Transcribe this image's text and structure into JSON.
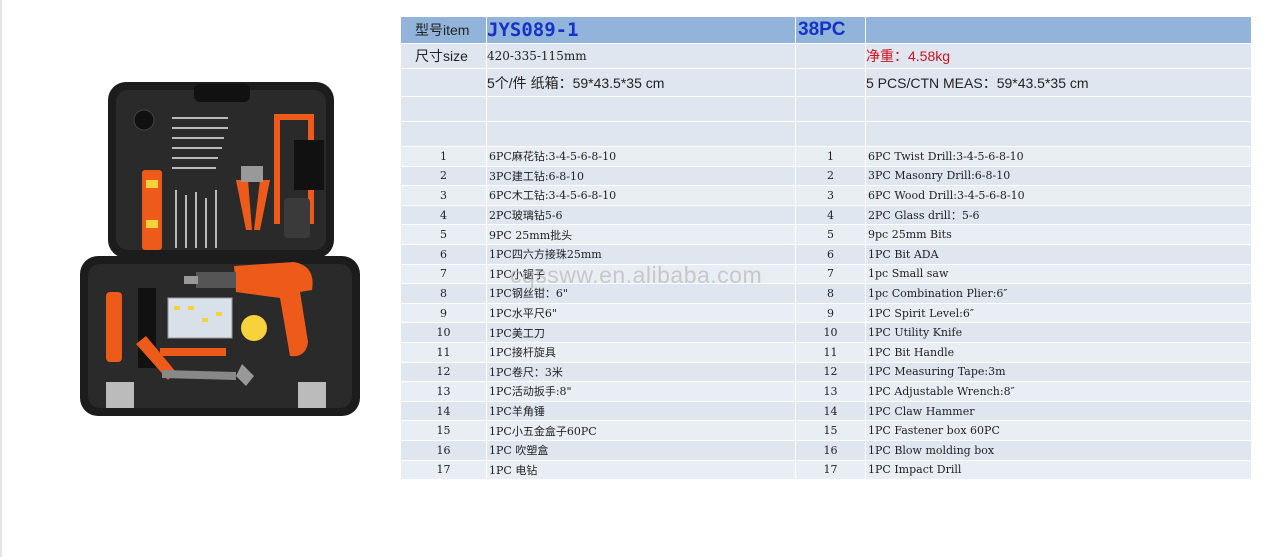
{
  "header": {
    "label": "型号item",
    "model": "JYS089-1",
    "piece_count": "38PC"
  },
  "size_row": {
    "label": "尺寸size",
    "value": "420-335-115mm",
    "weight": "净重：4.58kg"
  },
  "packing_row": {
    "cn": "5个/件  纸箱：59*43.5*35 cm",
    "en": "5 PCS/CTN   MEAS：59*43.5*35 cm"
  },
  "items": [
    {
      "no": "1",
      "cn": "6PC麻花钻:3-4-5-6-8-10",
      "en": "6PC Twist Drill:3-4-5-6-8-10"
    },
    {
      "no": "2",
      "cn": "3PC建工钻:6-8-10",
      "en": "3PC Masonry Drill:6-8-10"
    },
    {
      "no": "3",
      "cn": "6PC木工钻:3-4-5-6-8-10",
      "en": "6PC Wood Drill:3-4-5-6-8-10"
    },
    {
      "no": "4",
      "cn": "2PC玻璃钻5-6",
      "en": "2PC Glass drill：5-6"
    },
    {
      "no": "5",
      "cn": "9PC 25mm批头",
      "en": "9pc 25mm Bits"
    },
    {
      "no": "6",
      "cn": "1PC四六方接珠25mm",
      "en": "1PC Bit ADA"
    },
    {
      "no": "7",
      "cn": "1PC小锯子",
      "en": "1pc Small saw"
    },
    {
      "no": "8",
      "cn": "1PC钢丝钳：6\"",
      "en": "1pc Combination Plier:6″"
    },
    {
      "no": "9",
      "cn": "1PC水平尺6\"",
      "en": "1PC  Spirit Level:6″"
    },
    {
      "no": "10",
      "cn": "1PC美工刀",
      "en": "1PC Utility Knife"
    },
    {
      "no": "11",
      "cn": "1PC接杆旋具",
      "en": "1PC Bit Handle"
    },
    {
      "no": "12",
      "cn": "1PC卷尺：3米",
      "en": "1PC Measuring Tape:3m"
    },
    {
      "no": "13",
      "cn": "1PC活动扳手:8\"",
      "en": "1PC Adjustable Wrench:8″"
    },
    {
      "no": "14",
      "cn": "1PC羊角锤",
      "en": "1PC Claw Hammer"
    },
    {
      "no": "15",
      "cn": "1PC小五金盒子60PC",
      "en": "1PC Fastener box 60PC"
    },
    {
      "no": "16",
      "cn": "1PC 吹塑盒",
      "en": "1PC Blow molding box"
    },
    {
      "no": "17",
      "cn": "1PC 电钻",
      "en": "1PC Impact Drill"
    }
  ],
  "watermark": "cqssww.en.alibaba.com",
  "colors": {
    "header_bg": "#93b4da",
    "row_bg": "#dfe6f0",
    "case_black": "#1e1e1e",
    "tool_orange": "#ee5a1a",
    "model_blue": "#1533c8",
    "weight_red": "#d0101a"
  }
}
